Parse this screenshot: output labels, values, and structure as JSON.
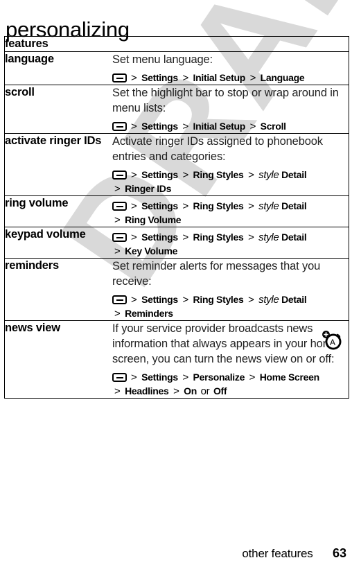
{
  "page": {
    "title": "personalizing",
    "watermark": "DRAFT",
    "footer_label": "other features",
    "footer_page_number": "63"
  },
  "table": {
    "header": {
      "label": "features"
    },
    "menu_key_icon": "menu-key-icon",
    "separator": ">",
    "rows": [
      {
        "feature": "language",
        "description": "Set menu language:",
        "path_lines": [
          [
            {
              "type": "key"
            },
            {
              "type": "sep",
              "text": ">"
            },
            {
              "type": "item",
              "text": "Settings"
            },
            {
              "type": "sep",
              "text": ">"
            },
            {
              "type": "item",
              "text": "Initial Setup"
            },
            {
              "type": "sep",
              "text": ">"
            },
            {
              "type": "item",
              "text": "Language"
            }
          ]
        ]
      },
      {
        "feature": "scroll",
        "description": "Set the highlight bar to stop or wrap around in menu lists:",
        "path_lines": [
          [
            {
              "type": "key"
            },
            {
              "type": "sep",
              "text": ">"
            },
            {
              "type": "item",
              "text": "Settings"
            },
            {
              "type": "sep",
              "text": ">"
            },
            {
              "type": "item",
              "text": "Initial Setup"
            },
            {
              "type": "sep",
              "text": ">"
            },
            {
              "type": "item",
              "text": "Scroll"
            }
          ]
        ]
      },
      {
        "feature": "activate ringer IDs",
        "description": "Activate ringer IDs assigned to phonebook entries and categories:",
        "path_lines": [
          [
            {
              "type": "key"
            },
            {
              "type": "sep",
              "text": ">"
            },
            {
              "type": "item",
              "text": "Settings"
            },
            {
              "type": "sep",
              "text": ">"
            },
            {
              "type": "item",
              "text": "Ring Styles"
            },
            {
              "type": "sep",
              "text": ">"
            },
            {
              "type": "italic",
              "text": "style"
            },
            {
              "type": "item",
              "text": "Detail"
            }
          ],
          [
            {
              "type": "sep",
              "text": ">"
            },
            {
              "type": "item",
              "text": "Ringer IDs"
            }
          ]
        ]
      },
      {
        "feature": "ring volume",
        "description": "",
        "path_lines": [
          [
            {
              "type": "key"
            },
            {
              "type": "sep",
              "text": ">"
            },
            {
              "type": "item",
              "text": "Settings"
            },
            {
              "type": "sep",
              "text": ">"
            },
            {
              "type": "item",
              "text": "Ring Styles"
            },
            {
              "type": "sep",
              "text": ">"
            },
            {
              "type": "italic",
              "text": "style"
            },
            {
              "type": "item",
              "text": "Detail"
            }
          ],
          [
            {
              "type": "sep",
              "text": ">"
            },
            {
              "type": "item",
              "text": "Ring Volume"
            }
          ]
        ]
      },
      {
        "feature": "keypad volume",
        "description": "",
        "path_lines": [
          [
            {
              "type": "key"
            },
            {
              "type": "sep",
              "text": ">"
            },
            {
              "type": "item",
              "text": "Settings"
            },
            {
              "type": "sep",
              "text": ">"
            },
            {
              "type": "item",
              "text": "Ring Styles"
            },
            {
              "type": "sep",
              "text": ">"
            },
            {
              "type": "italic",
              "text": "style"
            },
            {
              "type": "item",
              "text": "Detail"
            }
          ],
          [
            {
              "type": "sep",
              "text": ">"
            },
            {
              "type": "item",
              "text": "Key Volume"
            }
          ]
        ]
      },
      {
        "feature": "reminders",
        "description": "Set reminder alerts for messages that you receive:",
        "path_lines": [
          [
            {
              "type": "key"
            },
            {
              "type": "sep",
              "text": ">"
            },
            {
              "type": "item",
              "text": "Settings"
            },
            {
              "type": "sep",
              "text": ">"
            },
            {
              "type": "item",
              "text": "Ring Styles"
            },
            {
              "type": "sep",
              "text": ">"
            },
            {
              "type": "italic",
              "text": "style"
            },
            {
              "type": "item",
              "text": "Detail"
            }
          ],
          [
            {
              "type": "sep",
              "text": ">"
            },
            {
              "type": "item",
              "text": "Reminders"
            }
          ]
        ]
      },
      {
        "feature": "news view",
        "description": "If your service provider broadcasts news information that always appears in your home screen, you can turn the news view on or off:",
        "icon": "broadcast-news-icon",
        "path_lines": [
          [
            {
              "type": "key"
            },
            {
              "type": "sep",
              "text": ">"
            },
            {
              "type": "item",
              "text": "Settings"
            },
            {
              "type": "sep",
              "text": ">"
            },
            {
              "type": "item",
              "text": "Personalize"
            },
            {
              "type": "sep",
              "text": ">"
            },
            {
              "type": "item",
              "text": "Home Screen"
            }
          ],
          [
            {
              "type": "sep",
              "text": ">"
            },
            {
              "type": "item",
              "text": "Headlines"
            },
            {
              "type": "sep",
              "text": ">"
            },
            {
              "type": "item",
              "text": "On"
            },
            {
              "type": "plain",
              "text": "or"
            },
            {
              "type": "item",
              "text": "Off"
            }
          ]
        ]
      }
    ]
  },
  "colors": {
    "text": "#000000",
    "watermark": "#d9d9d9",
    "border": "#000000",
    "background": "#ffffff"
  }
}
